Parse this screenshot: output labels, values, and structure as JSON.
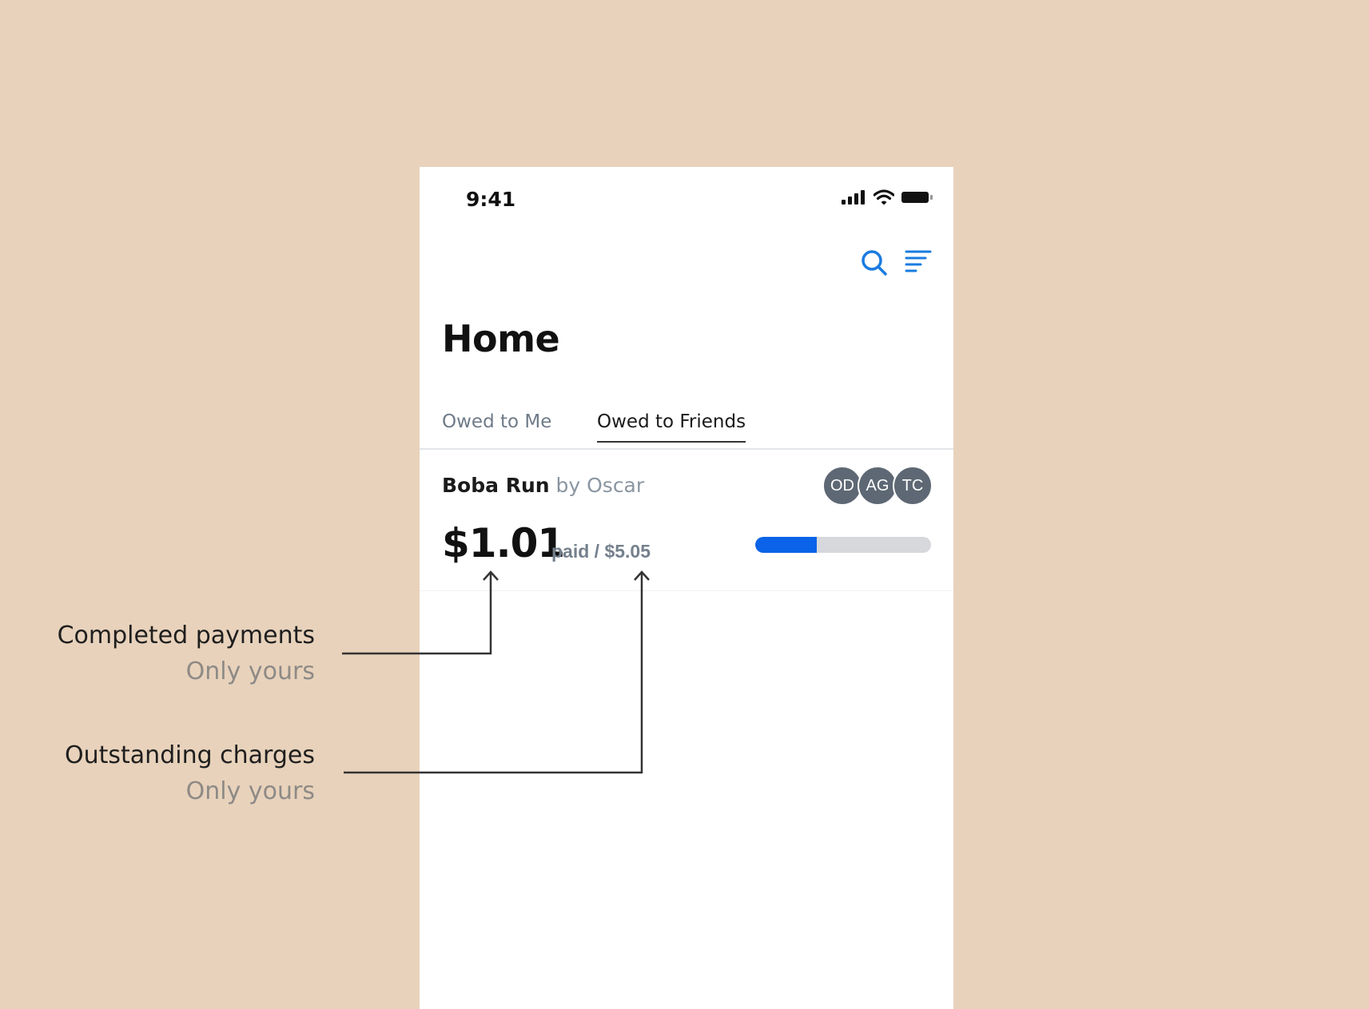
{
  "status_bar": {
    "time": "9:41",
    "icons": [
      "signal-icon",
      "wifi-icon",
      "battery-icon"
    ]
  },
  "toolbar": {
    "icons": [
      "search-icon",
      "filter-icon"
    ],
    "accent_color": "#1a7be0"
  },
  "page": {
    "title": "Home"
  },
  "tabs": [
    {
      "label": "Owed to Me",
      "active": false
    },
    {
      "label": "Owed to Friends",
      "active": true
    }
  ],
  "card": {
    "name": "Boba Run",
    "owner": "by Oscar",
    "avatars": [
      "OD",
      "AG",
      "TC"
    ],
    "amount": "$1.01",
    "amount_sub": "paid / $5.05",
    "progress": 0.35,
    "progress_color": "#0a63e8"
  },
  "annotations": [
    {
      "title": "Completed payments",
      "subtitle": "Only yours"
    },
    {
      "title": "Outstanding charges",
      "subtitle": "Only yours"
    }
  ],
  "colors": {
    "background": "#e8d2bb",
    "phone": "#ffffff",
    "muted_text": "#8a95a1"
  }
}
